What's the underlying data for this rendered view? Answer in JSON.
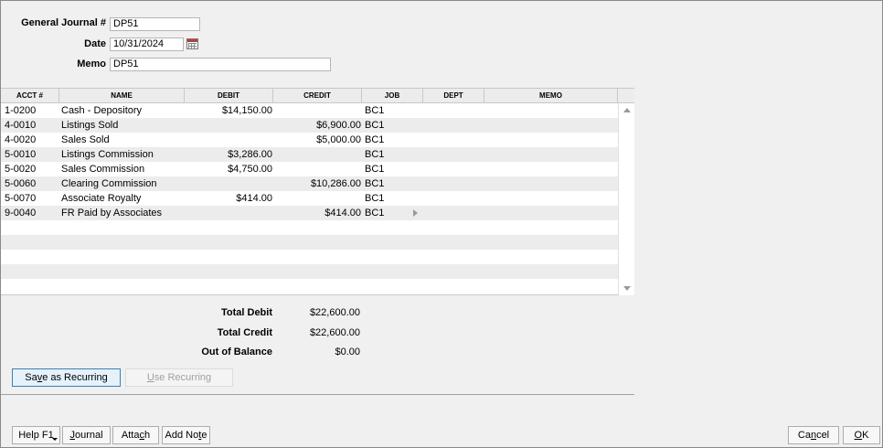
{
  "header": {
    "journal_label": "General Journal #",
    "journal_value": "DP51",
    "date_label": "Date",
    "date_value": "10/31/2024",
    "memo_label": "Memo",
    "memo_value": "DP51"
  },
  "grid": {
    "columns": [
      "ACCT #",
      "NAME",
      "DEBIT",
      "CREDIT",
      "JOB",
      "DEPT",
      "MEMO"
    ],
    "rows": [
      {
        "acct": "1-0200",
        "name": "Cash - Depository",
        "debit": "$14,150.00",
        "credit": "",
        "job": "BC1",
        "dept": "",
        "memo": ""
      },
      {
        "acct": "4-0010",
        "name": "Listings Sold",
        "debit": "",
        "credit": "$6,900.00",
        "job": "BC1",
        "dept": "",
        "memo": ""
      },
      {
        "acct": "4-0020",
        "name": "Sales Sold",
        "debit": "",
        "credit": "$5,000.00",
        "job": "BC1",
        "dept": "",
        "memo": ""
      },
      {
        "acct": "5-0010",
        "name": "Listings Commission",
        "debit": "$3,286.00",
        "credit": "",
        "job": "BC1",
        "dept": "",
        "memo": ""
      },
      {
        "acct": "5-0020",
        "name": "Sales Commission",
        "debit": "$4,750.00",
        "credit": "",
        "job": "BC1",
        "dept": "",
        "memo": ""
      },
      {
        "acct": "5-0060",
        "name": "Clearing Commission",
        "debit": "",
        "credit": "$10,286.00",
        "job": "BC1",
        "dept": "",
        "memo": ""
      },
      {
        "acct": "5-0070",
        "name": "Associate Royalty",
        "debit": "$414.00",
        "credit": "",
        "job": "BC1",
        "dept": "",
        "memo": ""
      },
      {
        "acct": "9-0040",
        "name": "FR Paid by Associates",
        "debit": "",
        "credit": "$414.00",
        "job": "BC1",
        "dept": "",
        "memo": ""
      }
    ]
  },
  "totals": {
    "total_debit_label": "Total Debit",
    "total_debit": "$22,600.00",
    "total_credit_label": "Total Credit",
    "total_credit": "$22,600.00",
    "balance_label": "Out of Balance",
    "balance": "$0.00"
  },
  "buttons": {
    "save_recurring_pre": "Sa",
    "save_recurring_key": "v",
    "save_recurring_post": "e as Recurring",
    "use_recurring_key": "U",
    "use_recurring_post": "se Recurring",
    "help": "Help F1",
    "journal_key": "J",
    "journal_post": "ournal",
    "attach_pre": "Atta",
    "attach_key": "c",
    "attach_post": "h",
    "addnote_pre": "Add No",
    "addnote_key": "t",
    "addnote_post": "e",
    "cancel_pre": "Ca",
    "cancel_key": "n",
    "cancel_post": "cel",
    "ok_key": "O",
    "ok_post": "K"
  },
  "icons": {
    "calendar": "calendar-icon",
    "scroll_up": "scroll-up-arrow-icon",
    "scroll_down": "scroll-down-arrow-icon",
    "row_pointer": "row-pointer-icon",
    "help_dropdown": "dropdown-arrow-icon"
  }
}
